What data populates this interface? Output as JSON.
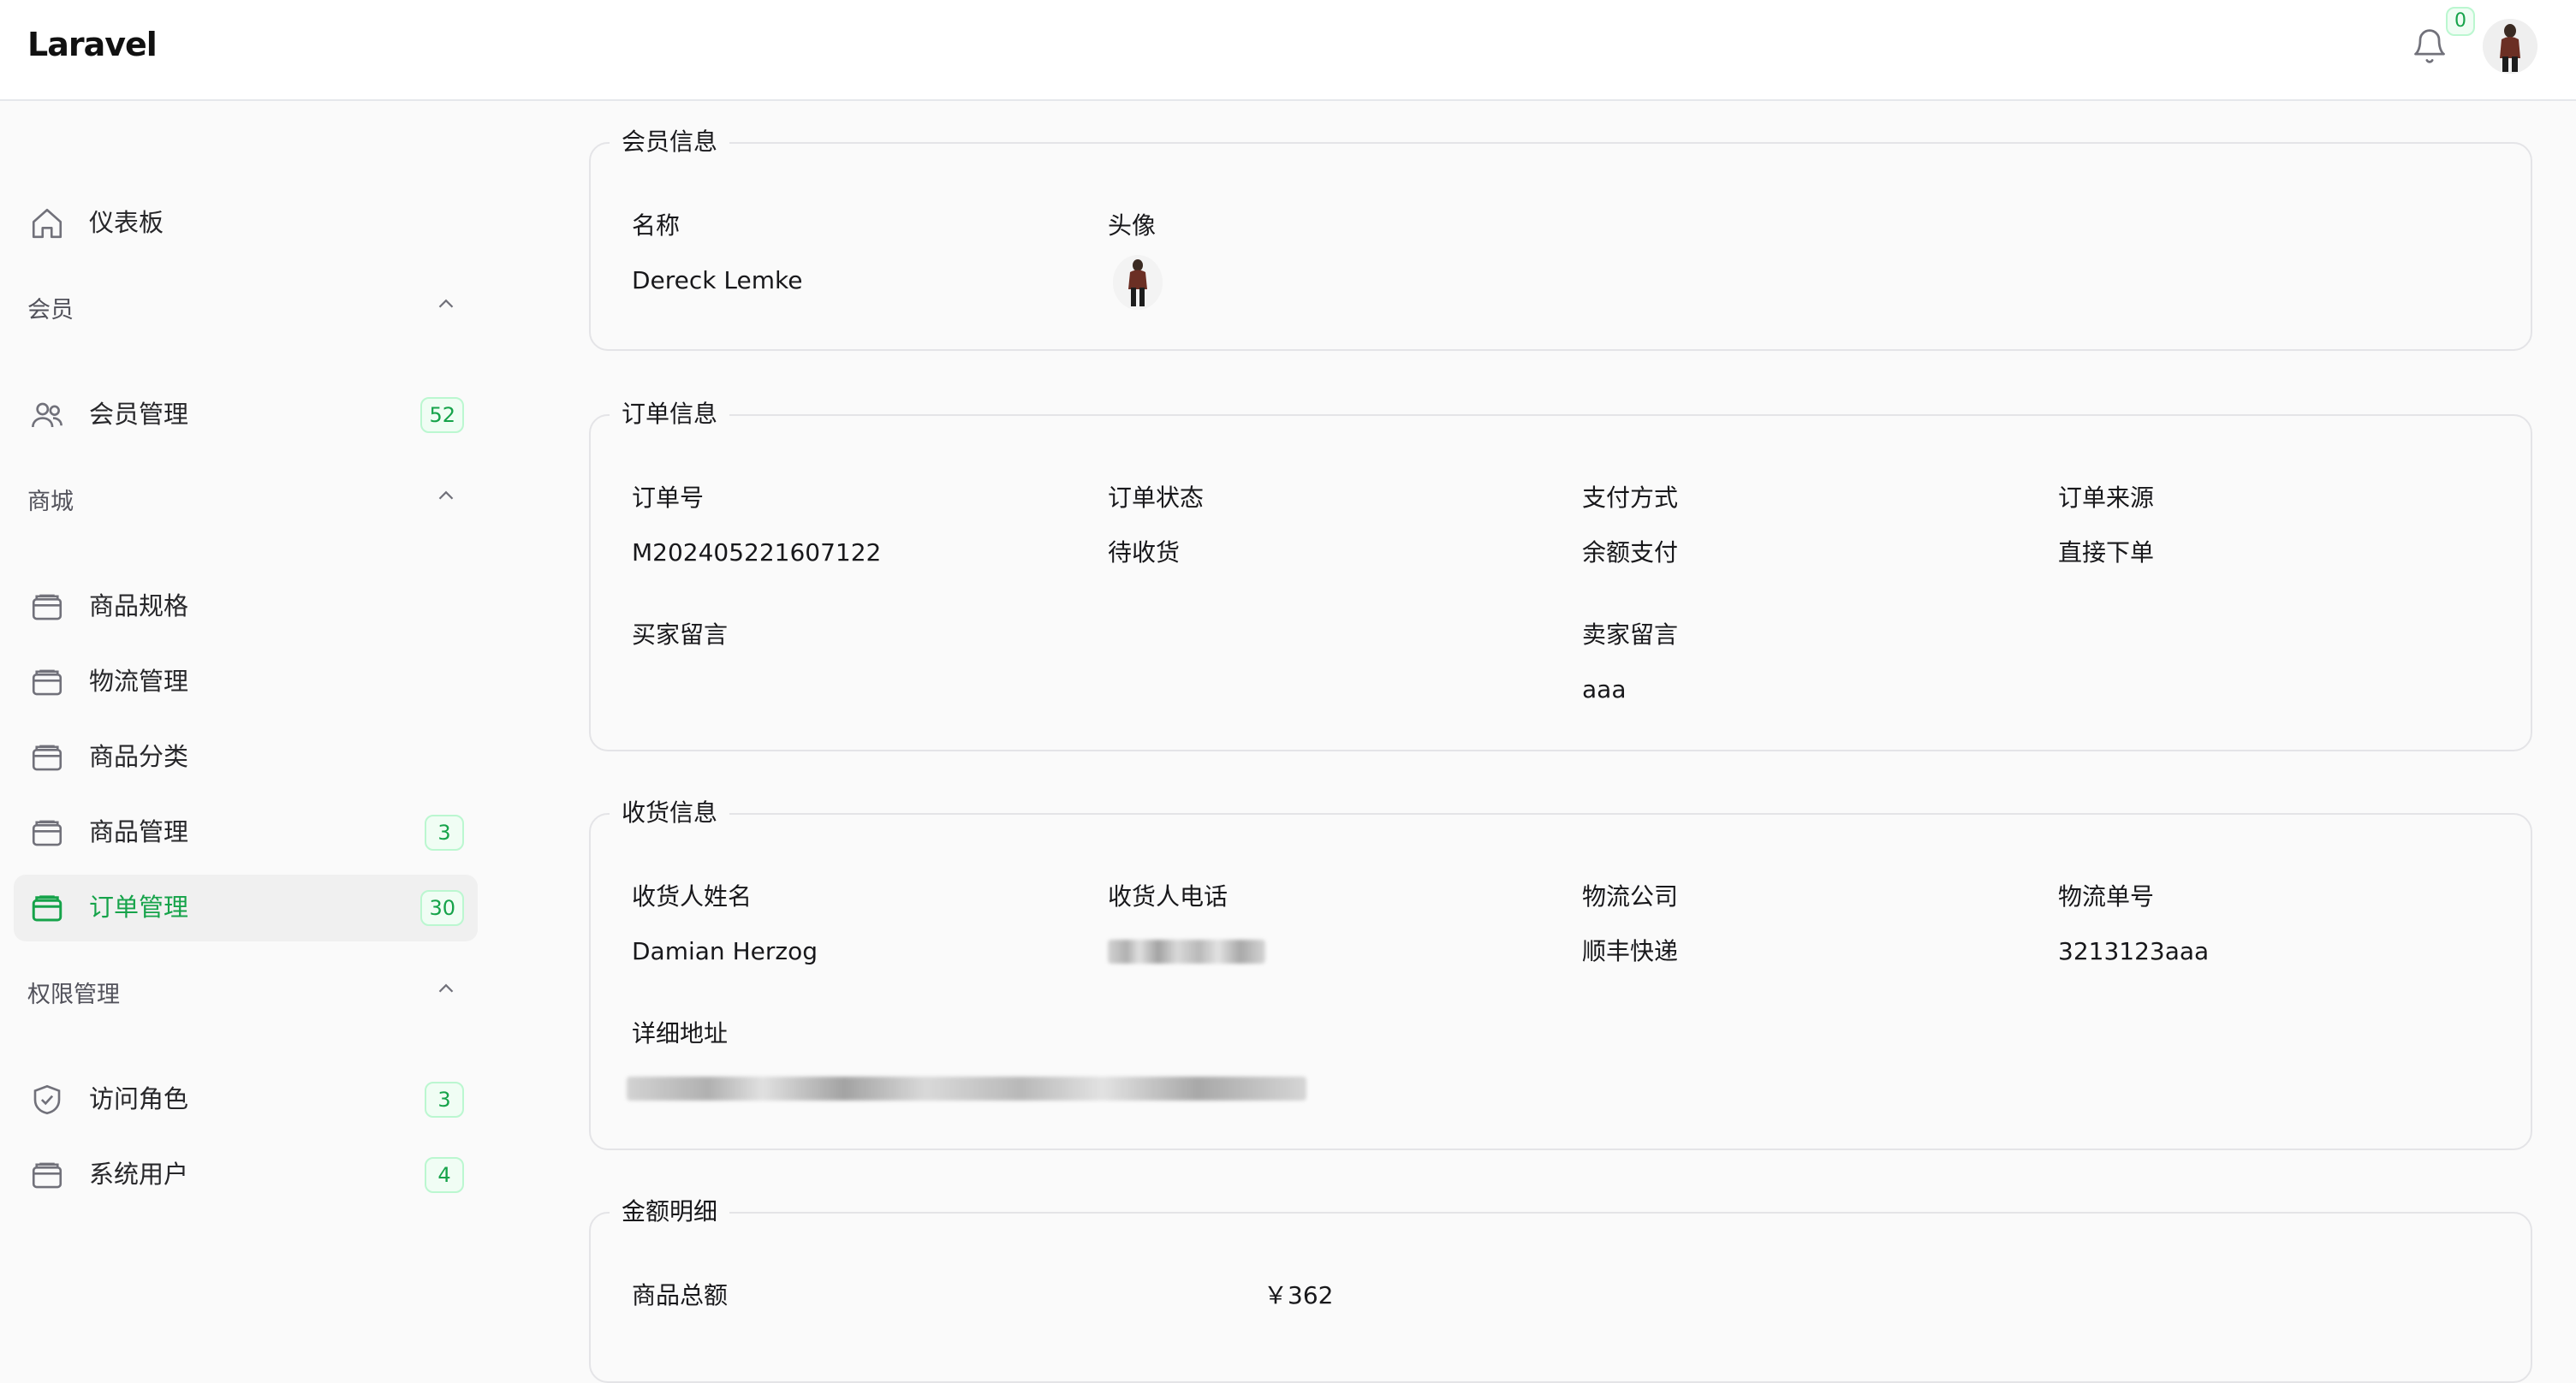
{
  "app": {
    "brand": "Laravel",
    "notification_count": "0"
  },
  "icons": {
    "bell": "bell-icon",
    "home": "home-icon",
    "users": "users-icon",
    "box": "box-icon",
    "shield": "shield-check-icon",
    "chevron": "chevron-up-icon"
  },
  "colors": {
    "accent": "#16a34a",
    "accent_bg": "#f0fdf4",
    "active_bg": "#f0f0f0",
    "border": "#e4e4e7"
  },
  "sidebar": {
    "dashboard": "仪表板",
    "group_member": "会员",
    "member_management": {
      "label": "会员管理",
      "count": "52"
    },
    "group_mall": "商城",
    "product_spec": "商品规格",
    "logistics": "物流管理",
    "category": "商品分类",
    "products": {
      "label": "商品管理",
      "count": "3"
    },
    "orders": {
      "label": "订单管理",
      "count": "30"
    },
    "group_permission": "权限管理",
    "roles": {
      "label": "访问角色",
      "count": "3"
    },
    "system_users": {
      "label": "系统用户",
      "count": "4"
    }
  },
  "member_info": {
    "legend": "会员信息",
    "name_label": "名称",
    "name_value": "Dereck Lemke",
    "avatar_label": "头像"
  },
  "order_info": {
    "legend": "订单信息",
    "order_no_label": "订单号",
    "order_no_value": "M202405221607122",
    "status_label": "订单状态",
    "status_value": "待收货",
    "payment_label": "支付方式",
    "payment_value": "余额支付",
    "source_label": "订单来源",
    "source_value": "直接下单",
    "buyer_msg_label": "买家留言",
    "buyer_msg_value": "",
    "seller_msg_label": "卖家留言",
    "seller_msg_value": "aaa"
  },
  "shipping_info": {
    "legend": "收货信息",
    "receiver_name_label": "收货人姓名",
    "receiver_name_value": "Damian Herzog",
    "receiver_phone_label": "收货人电话",
    "carrier_label": "物流公司",
    "carrier_value": "顺丰快递",
    "tracking_label": "物流单号",
    "tracking_value": "3213123aaa",
    "address_label": "详细地址"
  },
  "amount_info": {
    "legend": "金额明细",
    "goods_total_label": "商品总额",
    "goods_total_value": "￥362"
  }
}
